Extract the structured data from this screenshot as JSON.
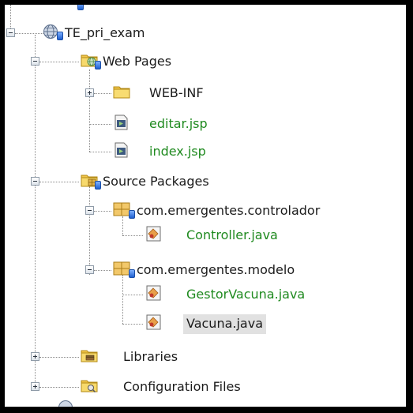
{
  "tree": {
    "project": {
      "label": "TE_pri_exam",
      "icon": "globe-project-icon"
    },
    "web_pages": {
      "label": "Web Pages",
      "icon": "web-folder-icon",
      "children": [
        {
          "label": "WEB-INF",
          "icon": "folder-icon"
        },
        {
          "label": "editar.jsp",
          "icon": "jsp-file-icon"
        },
        {
          "label": "index.jsp",
          "icon": "jsp-file-icon"
        }
      ]
    },
    "source_packages": {
      "label": "Source Packages",
      "icon": "source-folder-icon",
      "packages": [
        {
          "label": "com.emergentes.controlador",
          "icon": "package-icon",
          "files": [
            {
              "label": "Controller.java",
              "icon": "java-file-icon"
            }
          ]
        },
        {
          "label": "com.emergentes.modelo",
          "icon": "package-icon",
          "files": [
            {
              "label": "GestorVacuna.java",
              "icon": "java-file-icon"
            },
            {
              "label": "Vacuna.java",
              "icon": "java-file-icon"
            }
          ]
        }
      ]
    },
    "libraries": {
      "label": "Libraries",
      "icon": "libraries-icon"
    },
    "configuration_files": {
      "label": "Configuration Files",
      "icon": "config-files-icon"
    }
  },
  "colors": {
    "modified_file_text": "#1f8a1f",
    "selected_row_bg": "#e1e1e1"
  }
}
